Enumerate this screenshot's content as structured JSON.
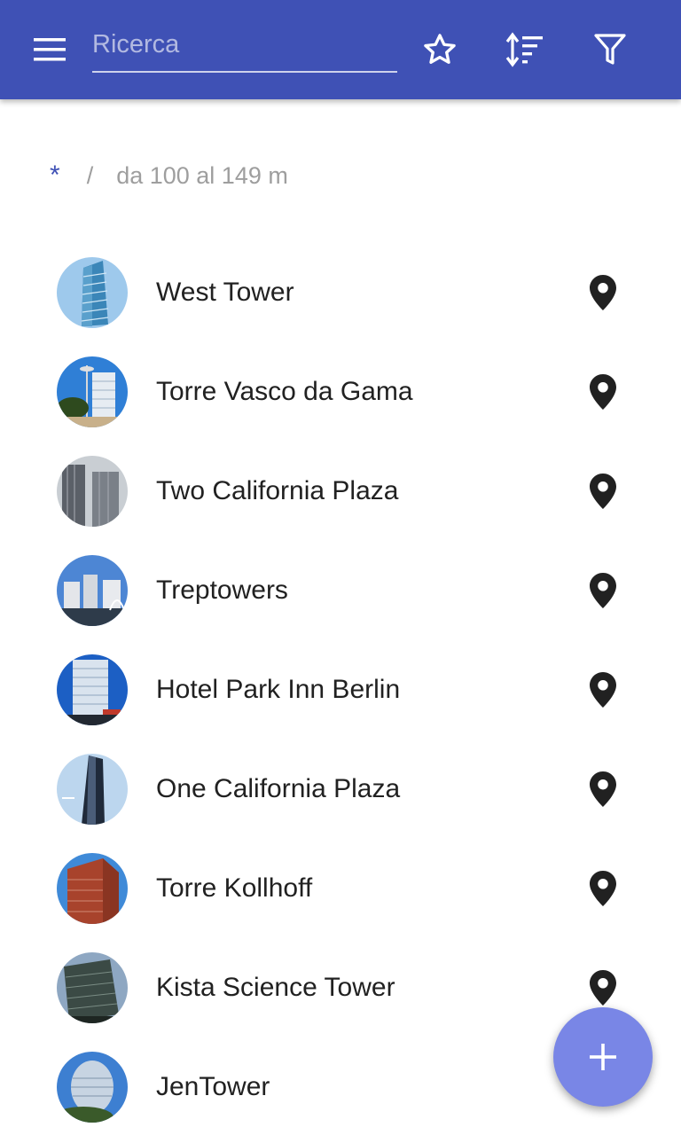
{
  "toolbar": {
    "menu_icon": "menu-icon",
    "search": {
      "placeholder": "Ricerca",
      "value": ""
    },
    "favorites_icon": "star-outline-icon",
    "sort_icon": "sort-icon",
    "filter_icon": "filter-icon",
    "accent_color": "#3f51b5"
  },
  "breadcrumb": {
    "root": "*",
    "separator": "/",
    "current": "da 100 al 149 m"
  },
  "buildings": [
    {
      "name": "West Tower",
      "icon": "map-marker-icon"
    },
    {
      "name": "Torre Vasco da Gama",
      "icon": "map-marker-icon"
    },
    {
      "name": "Two California Plaza",
      "icon": "map-marker-icon"
    },
    {
      "name": "Treptowers",
      "icon": "map-marker-icon"
    },
    {
      "name": "Hotel Park Inn Berlin",
      "icon": "map-marker-icon"
    },
    {
      "name": "One California Plaza",
      "icon": "map-marker-icon"
    },
    {
      "name": "Torre Kollhoff",
      "icon": "map-marker-icon"
    },
    {
      "name": "Kista Science Tower",
      "icon": "map-marker-icon"
    },
    {
      "name": "JenTower",
      "icon": "map-marker-icon"
    }
  ],
  "fab": {
    "icon": "plus-icon",
    "color": "#7986e6"
  }
}
